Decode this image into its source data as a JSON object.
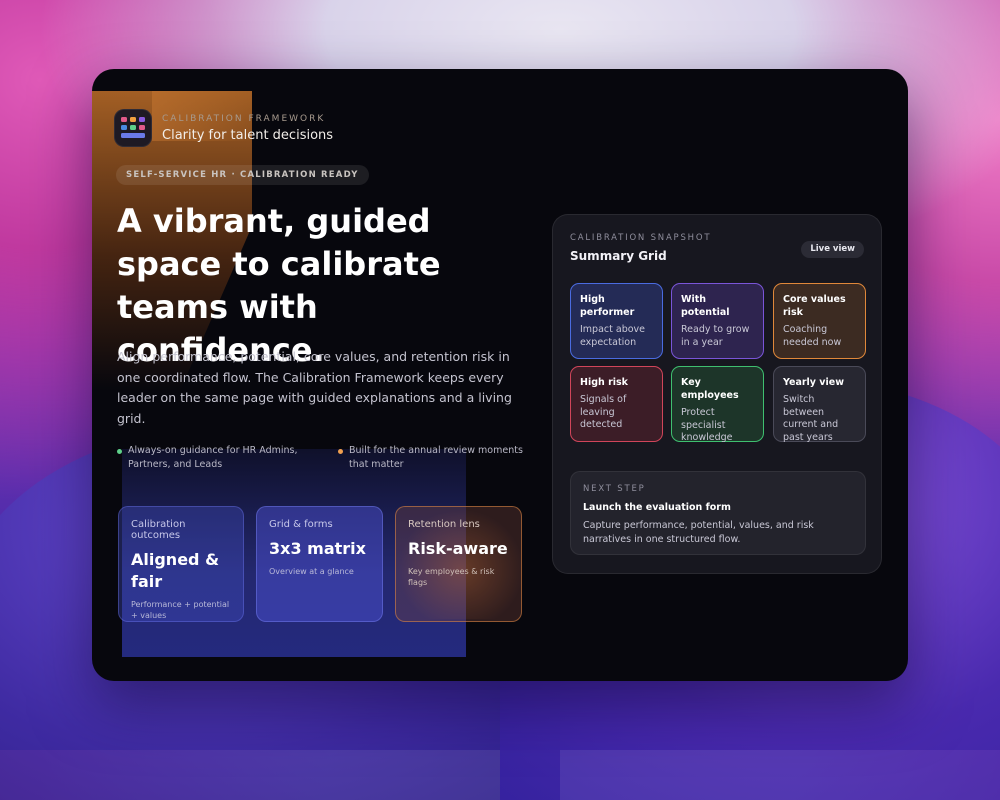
{
  "brand": {
    "eyebrow": "CALIBRATION FRAMEWORK",
    "tagline": "Clarity for talent decisions",
    "icon": "grid-app-icon"
  },
  "badge": "SELF-SERVICE HR · CALIBRATION READY",
  "hero": {
    "title": "A vibrant, guided space to calibrate teams with confidence.",
    "description": "Align performance, potential, core values, and retention risk in one coordinated flow. The Calibration Framework keeps every leader on the same page with guided explanations and a living grid."
  },
  "bullets": [
    {
      "text": "Always-on guidance for HR Admins, Partners, and Leads",
      "color": "#5fd08a"
    },
    {
      "text": "Built for the annual review moments that matter",
      "color": "#f0a050"
    }
  ],
  "stats": [
    {
      "label": "Calibration outcomes",
      "value": "Aligned & fair",
      "note": "Performance + potential + values"
    },
    {
      "label": "Grid & forms",
      "value": "3x3 matrix",
      "note": "Overview at a glance"
    },
    {
      "label": "Retention lens",
      "value": "Risk-aware",
      "note": "Key employees & risk flags"
    }
  ],
  "snapshot": {
    "eyebrow": "CALIBRATION SNAPSHOT",
    "title": "Summary Grid",
    "live_label": "Live view",
    "cells": [
      {
        "title": "High performer",
        "body": "Impact above expectation",
        "color": "#4a6be0"
      },
      {
        "title": "With potential",
        "body": "Ready to grow in a year",
        "color": "#7a55d8"
      },
      {
        "title": "Core values risk",
        "body": "Coaching needed now",
        "color": "#e0883a"
      },
      {
        "title": "High risk",
        "body": "Signals of leaving detected",
        "color": "#d0455a"
      },
      {
        "title": "Key employees",
        "body": "Protect specialist knowledge",
        "color": "#3fbf6f"
      },
      {
        "title": "Yearly view",
        "body": "Switch between current and past years",
        "color": "#6a6a78"
      }
    ],
    "next_step": {
      "eyebrow": "NEXT STEP",
      "title": "Launch the evaluation form",
      "body": "Capture performance, potential, values, and risk narratives in one structured flow."
    }
  }
}
